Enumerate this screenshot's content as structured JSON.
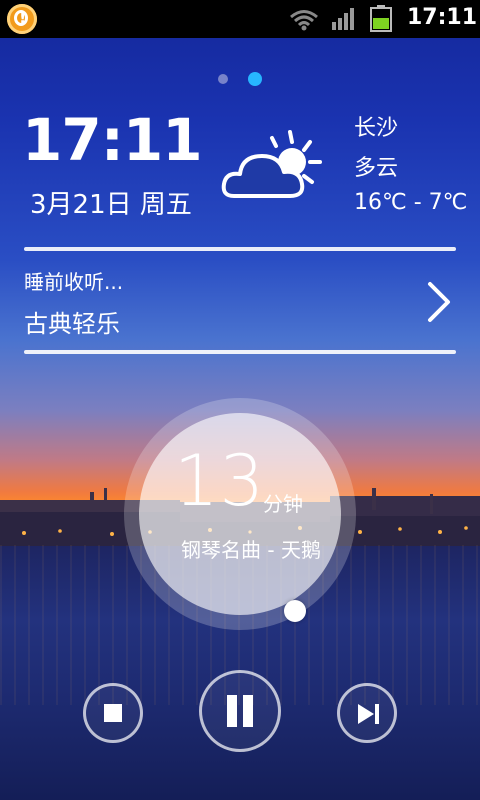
{
  "status_bar": {
    "time": "17:11",
    "icons": [
      "app-alert-icon",
      "wifi-icon",
      "signal-icon",
      "battery-icon"
    ]
  },
  "pager": {
    "active_index": 1,
    "count": 2
  },
  "clock": {
    "time": "17:11",
    "date": "3月21日 周五"
  },
  "weather": {
    "city": "长沙",
    "condition": "多云",
    "temperature": "16℃ - 7℃",
    "icon": "partly-cloudy-icon"
  },
  "playlist": {
    "subtitle": "睡前收听...",
    "title": "古典轻乐"
  },
  "timer": {
    "minutes": "13",
    "unit": "分钟",
    "track": "钢琴名曲 - 天鹅"
  },
  "controls": [
    "stop-icon",
    "pause-icon",
    "next-icon"
  ],
  "colors": {
    "accent": "#27b6ff",
    "status_bar": "#000000"
  }
}
